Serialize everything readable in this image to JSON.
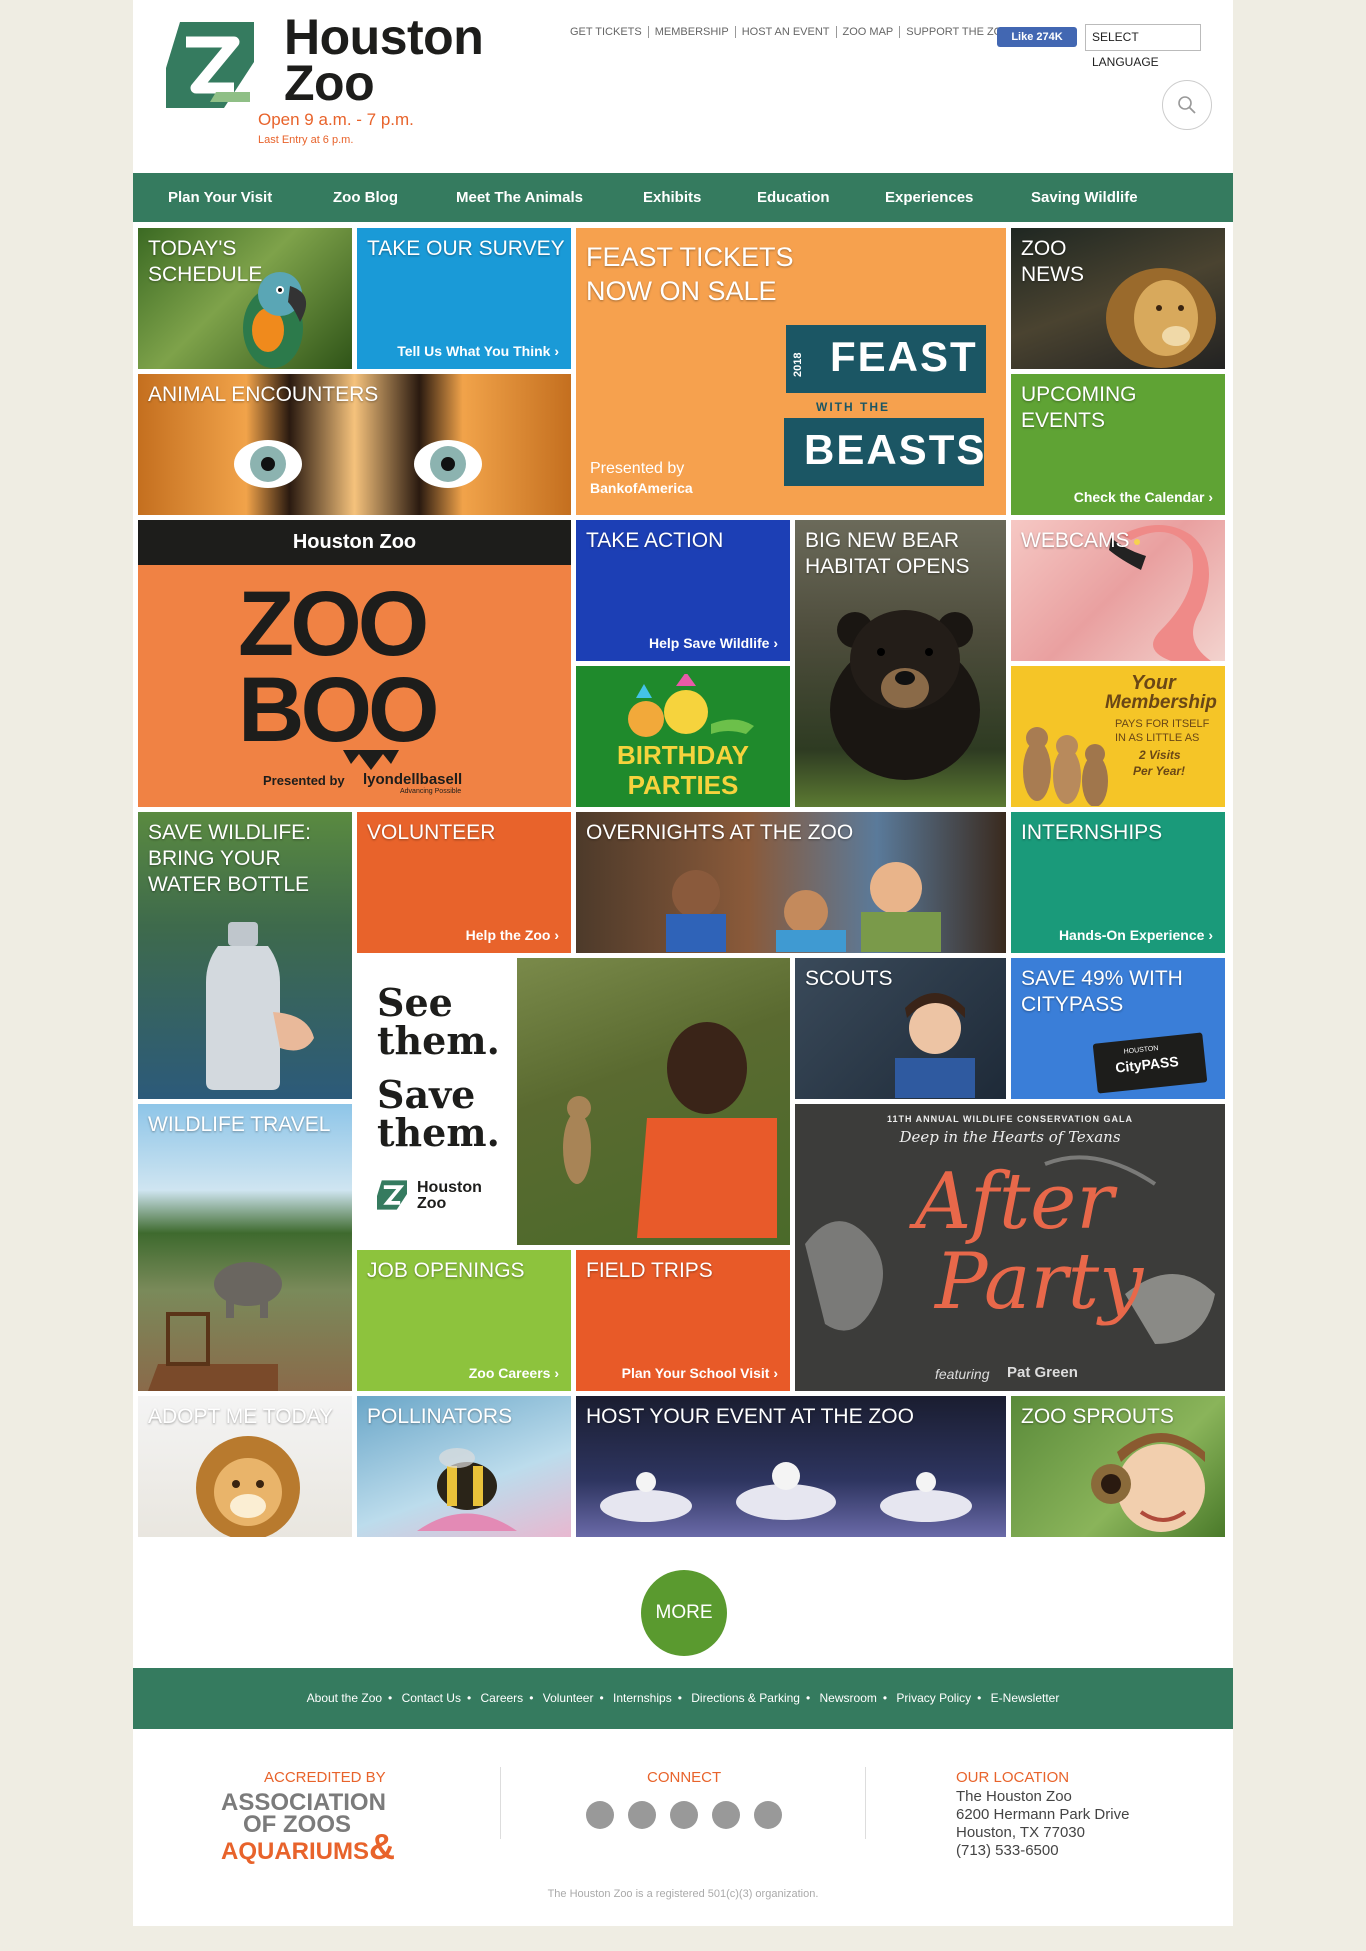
{
  "header": {
    "logo_line1": "Houston",
    "logo_line2": "Zoo",
    "hours": "Open 9 a.m. - 7 p.m.",
    "last_entry": "Last Entry at 6 p.m.",
    "top_links": [
      "GET TICKETS",
      "MEMBERSHIP",
      "HOST AN EVENT",
      "ZOO MAP",
      "SUPPORT THE ZOO"
    ],
    "fb_like": "Like 274K",
    "language": "SELECT LANGUAGE"
  },
  "nav": [
    "Plan Your Visit",
    "Zoo Blog",
    "Meet The Animals",
    "Exhibits",
    "Education",
    "Experiences",
    "Saving Wildlife"
  ],
  "tiles": {
    "schedule": {
      "title": "TODAY'S SCHEDULE"
    },
    "survey": {
      "title": "TAKE OUR SURVEY",
      "sub": "Tell Us What You Think"
    },
    "feast": {
      "title": "FEAST TICKETS NOW ON SALE",
      "year": "2018",
      "word1": "FEAST",
      "word2": "WITH THE",
      "word3": "BEASTS",
      "presented": "Presented by",
      "sponsor": "BankofAmerica"
    },
    "news": {
      "title": "ZOO NEWS"
    },
    "encounters": {
      "title": "ANIMAL ENCOUNTERS"
    },
    "events": {
      "title": "UPCOMING EVENTS",
      "sub": "Check the Calendar"
    },
    "zooboo": {
      "header": "Houston Zoo",
      "word1": "ZOO",
      "word2": "BOO",
      "presented": "Presented by",
      "sponsor": "lyondellbasell",
      "tagline": "Advancing Possible"
    },
    "action": {
      "title": "TAKE ACTION",
      "sub": "Help Save Wildlife"
    },
    "bear": {
      "title": "BIG NEW BEAR HABITAT OPENS"
    },
    "webcams": {
      "title": "WEBCAMS"
    },
    "birthday": {
      "line1": "BIRTHDAY",
      "line2": "PARTIES"
    },
    "membership": {
      "line1": "Your",
      "line2": "Membership",
      "line3": "PAYS FOR ITSELF",
      "line4": "IN AS LITTLE AS",
      "line5": "2 Visits",
      "line6": "Per Year!"
    },
    "bottle": {
      "title": "SAVE WILDLIFE: BRING YOUR WATER BOTTLE"
    },
    "volunteer": {
      "title": "VOLUNTEER",
      "sub": "Help the Zoo"
    },
    "overnights": {
      "title": "OVERNIGHTS AT THE ZOO"
    },
    "internships": {
      "title": "INTERNSHIPS",
      "sub": "Hands-On Experience"
    },
    "seethem": {
      "line1": "See",
      "line2": "them.",
      "line3": "Save",
      "line4": "them.",
      "brand1": "Houston",
      "brand2": "Zoo"
    },
    "scouts": {
      "title": "SCOUTS"
    },
    "citypass": {
      "title": "SAVE 49% WITH CITYPASS",
      "ticket_top": "HOUSTON",
      "ticket": "CityPASS"
    },
    "travel": {
      "title": "WILDLIFE TRAVEL"
    },
    "gala": {
      "line1": "11TH ANNUAL WILDLIFE CONSERVATION GALA",
      "line2": "Deep in the Hearts of Texans",
      "word1": "After",
      "word2": "Party",
      "featuring": "featuring",
      "artist": "Pat Green"
    },
    "jobs": {
      "title": "JOB OPENINGS",
      "sub": "Zoo Careers"
    },
    "fieldtrips": {
      "title": "FIELD TRIPS",
      "sub": "Plan Your School Visit"
    },
    "adopt": {
      "title": "ADOPT ME TODAY"
    },
    "pollinators": {
      "title": "POLLINATORS"
    },
    "host": {
      "title": "HOST YOUR EVENT AT THE ZOO"
    },
    "sprouts": {
      "title": "ZOO SPROUTS"
    }
  },
  "more": "MORE",
  "footer": {
    "links": [
      "About the Zoo",
      "Contact Us",
      "Careers",
      "Volunteer",
      "Internships",
      "Directions & Parking",
      "Newsroom",
      "Privacy Policy",
      "E-Newsletter"
    ],
    "accredited": "ACCREDITED BY",
    "aza1": "ASSOCIATION",
    "aza2": "OF ZOOS",
    "aza3": "AQUARIUMS",
    "aza_amp": "&",
    "connect": "CONNECT",
    "location_head": "OUR LOCATION",
    "location": [
      "The Houston Zoo",
      "6200 Hermann Park Drive",
      "Houston, TX 77030",
      "(713) 533-6500"
    ],
    "legal": "The Houston Zoo is a registered 501(c)(3) organization."
  },
  "colors": {
    "nav_green": "#357b5f",
    "brand_orange": "#e8632b",
    "survey_blue": "#1a9ad7",
    "action_blue": "#1c3fb5",
    "events_green": "#5fa334",
    "intern_teal": "#1a9a7a",
    "volunteer_orange": "#e8632b"
  }
}
